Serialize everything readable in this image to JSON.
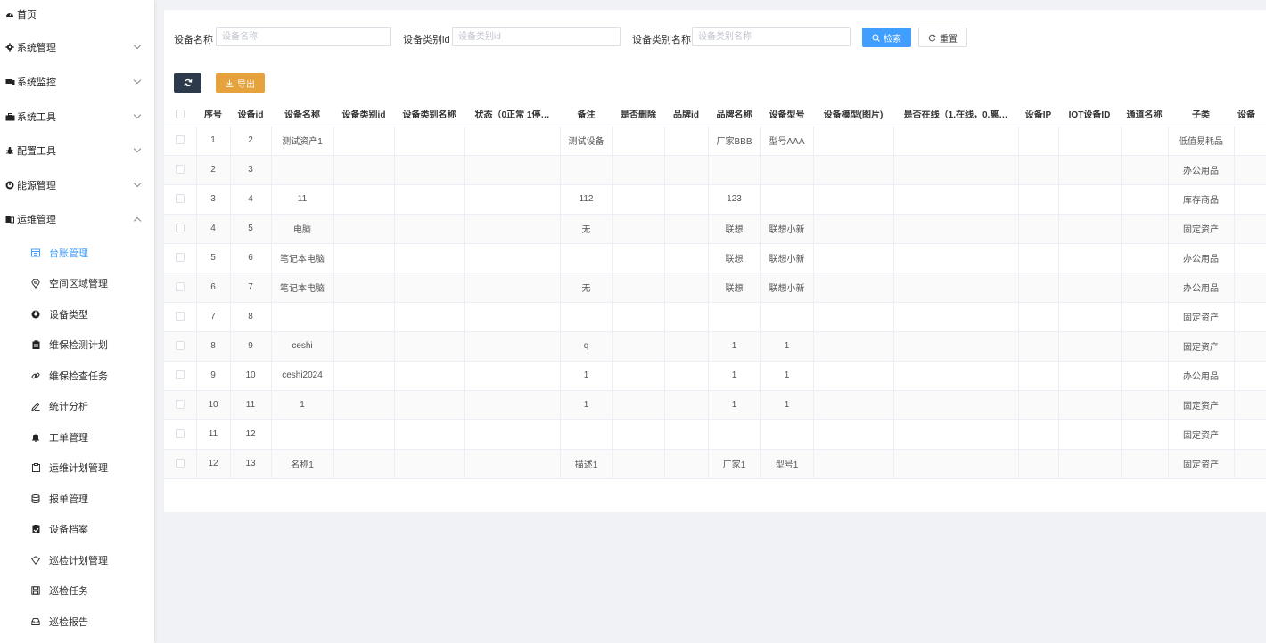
{
  "sidebar": {
    "items": [
      {
        "label": "首页",
        "icon": "dashboard-icon"
      },
      {
        "label": "系统管理",
        "icon": "gear-icon"
      },
      {
        "label": "系统监控",
        "icon": "monitor-icon"
      },
      {
        "label": "系统工具",
        "icon": "toolbox-icon"
      },
      {
        "label": "配置工具",
        "icon": "bug-icon"
      },
      {
        "label": "能源管理",
        "icon": "power-icon"
      },
      {
        "label": "运维管理",
        "icon": "maintenance-icon"
      }
    ],
    "sub_items": [
      {
        "label": "台账管理",
        "icon": "ledger-icon"
      },
      {
        "label": "空间区域管理",
        "icon": "location-pin-icon"
      },
      {
        "label": "设备类型",
        "icon": "device-type-icon"
      },
      {
        "label": "维保检测计划",
        "icon": "clipboard-icon"
      },
      {
        "label": "维保检查任务",
        "icon": "link-icon"
      },
      {
        "label": "统计分析",
        "icon": "pen-icon"
      },
      {
        "label": "工单管理",
        "icon": "bell-icon"
      },
      {
        "label": "运维计划管理",
        "icon": "clipboard-outline-icon"
      },
      {
        "label": "报单管理",
        "icon": "database-icon"
      },
      {
        "label": "设备档案",
        "icon": "clipboard-check-icon"
      },
      {
        "label": "巡检计划管理",
        "icon": "shield-icon"
      },
      {
        "label": "巡检任务",
        "icon": "save-icon"
      },
      {
        "label": "巡检报告",
        "icon": "inbox-icon"
      }
    ]
  },
  "search": {
    "device_name_label": "设备名称",
    "device_name_placeholder": "设备名称",
    "category_id_label": "设备类别id",
    "category_id_placeholder": "设备类别id",
    "category_name_label": "设备类别名称",
    "category_name_placeholder": "设备类别名称",
    "search_button": "检索",
    "reset_button": "重置"
  },
  "toolbar": {
    "refresh_icon": "refresh-icon",
    "export_label": "导出"
  },
  "table": {
    "columns": [
      "序号",
      "设备id",
      "设备名称",
      "设备类别id",
      "设备类别名称",
      "状态（0正常 1停…",
      "备注",
      "是否删除",
      "品牌id",
      "品牌名称",
      "设备型号",
      "设备模型(图片)",
      "是否在线（1.在线，0.离…",
      "设备IP",
      "IOT设备ID",
      "通道名称",
      "子类",
      "设备"
    ],
    "rows": [
      [
        "1",
        "2",
        "测试资产1",
        "",
        "",
        "",
        "测试设备",
        "",
        "",
        "厂家BBB",
        "型号AAA",
        "",
        "",
        "",
        "",
        "",
        "低值易耗品",
        ""
      ],
      [
        "2",
        "3",
        "",
        "",
        "",
        "",
        "",
        "",
        "",
        "",
        "",
        "",
        "",
        "",
        "",
        "",
        "办公用品",
        ""
      ],
      [
        "3",
        "4",
        "11",
        "",
        "",
        "",
        "112",
        "",
        "",
        "123",
        "",
        "",
        "",
        "",
        "",
        "",
        "库存商品",
        ""
      ],
      [
        "4",
        "5",
        "电脑",
        "",
        "",
        "",
        "无",
        "",
        "",
        "联想",
        "联想小新",
        "",
        "",
        "",
        "",
        "",
        "固定资产",
        ""
      ],
      [
        "5",
        "6",
        "笔记本电脑",
        "",
        "",
        "",
        "",
        "",
        "",
        "联想",
        "联想小新",
        "",
        "",
        "",
        "",
        "",
        "办公用品",
        ""
      ],
      [
        "6",
        "7",
        "笔记本电脑",
        "",
        "",
        "",
        "无",
        "",
        "",
        "联想",
        "联想小新",
        "",
        "",
        "",
        "",
        "",
        "办公用品",
        ""
      ],
      [
        "7",
        "8",
        "",
        "",
        "",
        "",
        "",
        "",
        "",
        "",
        "",
        "",
        "",
        "",
        "",
        "",
        "固定资产",
        ""
      ],
      [
        "8",
        "9",
        "ceshi",
        "",
        "",
        "",
        "q",
        "",
        "",
        "1",
        "1",
        "",
        "",
        "",
        "",
        "",
        "固定资产",
        ""
      ],
      [
        "9",
        "10",
        "ceshi2024",
        "",
        "",
        "",
        "1",
        "",
        "",
        "1",
        "1",
        "",
        "",
        "",
        "",
        "",
        "办公用品",
        ""
      ],
      [
        "10",
        "11",
        "1",
        "",
        "",
        "",
        "1",
        "",
        "",
        "1",
        "1",
        "",
        "",
        "",
        "",
        "",
        "固定资产",
        ""
      ],
      [
        "11",
        "12",
        "",
        "",
        "",
        "",
        "",
        "",
        "",
        "",
        "",
        "",
        "",
        "",
        "",
        "",
        "固定资产",
        ""
      ],
      [
        "12",
        "13",
        "名称1",
        "",
        "",
        "",
        "描述1",
        "",
        "",
        "厂家1",
        "型号1",
        "",
        "",
        "",
        "",
        "",
        "固定资产",
        ""
      ]
    ]
  },
  "colors": {
    "primary": "#409eff",
    "warning": "#e6a23c",
    "dark_button": "#2d3a4b"
  }
}
